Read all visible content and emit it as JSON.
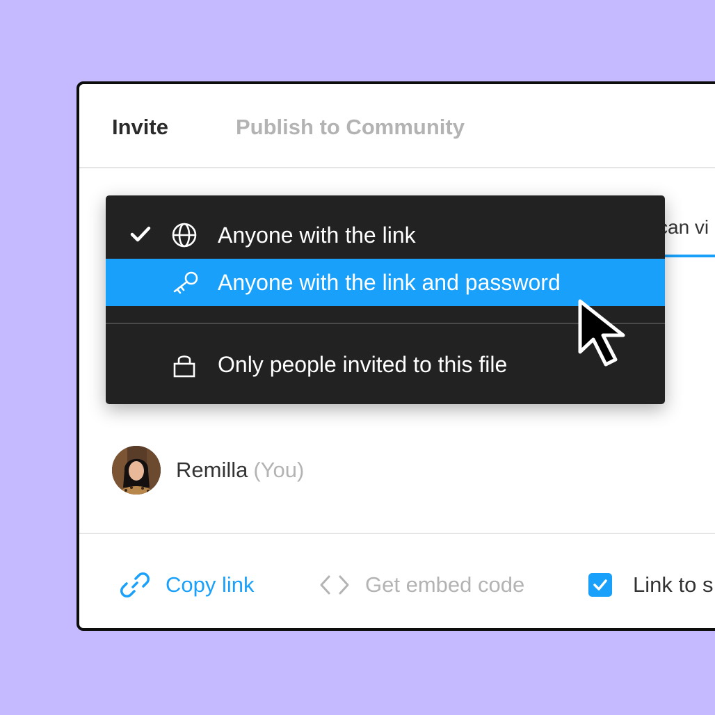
{
  "tabs": {
    "invite": "Invite",
    "publish": "Publish to Community"
  },
  "permission_select": {
    "value": "can vi"
  },
  "share_menu": {
    "items": [
      {
        "label": "Anyone with the link",
        "icon": "globe-icon",
        "checked": true
      },
      {
        "label": "Anyone with the link and password",
        "icon": "key-icon",
        "highlighted": true
      },
      {
        "label": "Only people invited to this file",
        "icon": "lock-icon"
      }
    ]
  },
  "user": {
    "name": "Remilla",
    "tag": "(You)"
  },
  "footer": {
    "copy_link": "Copy link",
    "embed": "Get embed code",
    "link_to": "Link to s"
  },
  "colors": {
    "background": "#c5b9ff",
    "accent": "#18a0fb",
    "menu_bg": "#222222",
    "panel_border": "#0d0d0d"
  }
}
